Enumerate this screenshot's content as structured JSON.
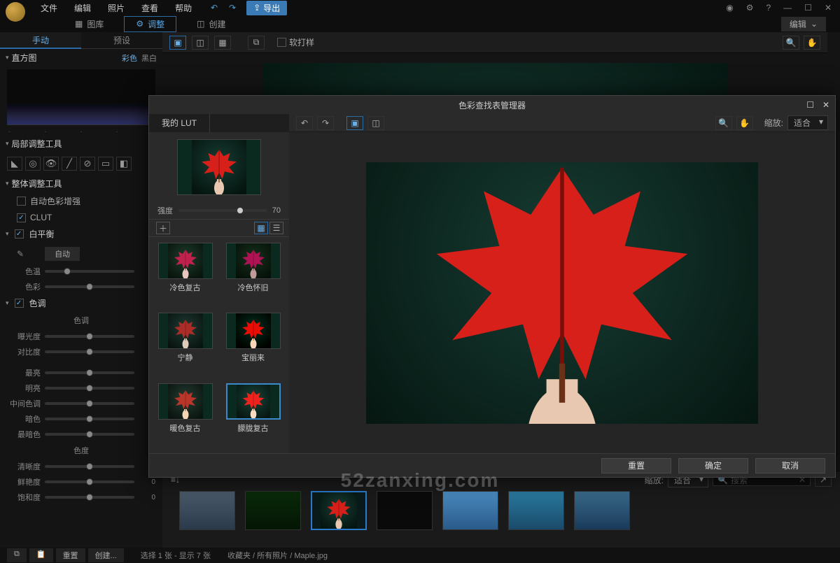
{
  "menubar": {
    "items": [
      "文件",
      "编辑",
      "照片",
      "查看",
      "帮助"
    ],
    "export": "导出",
    "edit_dd": "编辑"
  },
  "modules": {
    "library": "图库",
    "adjust": "调整",
    "create": "创建"
  },
  "left": {
    "tabs": {
      "manual": "手动",
      "preset": "预设"
    },
    "histogram": {
      "title": "直方图",
      "color": "彩色",
      "bw": "黑白"
    },
    "local": "局部调整工具",
    "global": "整体调整工具",
    "auto_enhance": "自动色彩增强",
    "clut": "CLUT",
    "wb": {
      "title": "白平衡",
      "auto": "自动",
      "temp": "色温",
      "tint": "色彩"
    },
    "tone": {
      "title": "色调",
      "sub": "色调",
      "exposure": "曝光度",
      "contrast": "对比度",
      "brightest": "最亮",
      "bright": "明亮",
      "midtone": "中间色调",
      "dark": "暗色",
      "darkest": "最暗色"
    },
    "chroma": {
      "title": "色度",
      "clarity": "清晰度",
      "vibrance": "鲜艳度",
      "saturation": "饱和度"
    },
    "zero": "0",
    "zerof": "0."
  },
  "bottom": {
    "reset": "重置",
    "create": "创建...",
    "sort": "≡↓",
    "zoom_lbl": "缩放:",
    "zoom_val": "适合",
    "search_ph": "搜索"
  },
  "status": {
    "selection": "选择 1 张 - 显示 7 张",
    "path": "收藏夹 / 所有照片 / Maple.jpg"
  },
  "viewer": {
    "softproof": "软打样"
  },
  "modal": {
    "title": "色彩查找表管理器",
    "my_lut": "我的 LUT",
    "intensity_lbl": "强度",
    "intensity_val": "70",
    "zoom_lbl": "缩放:",
    "zoom_val": "适合",
    "reset": "重置",
    "ok": "确定",
    "cancel": "取消",
    "presets": [
      "冷色复古",
      "冷色怀旧",
      "宁静",
      "宝丽来",
      "暖色复古",
      "朦胧复古"
    ]
  },
  "watermark": "52zanxing.com"
}
